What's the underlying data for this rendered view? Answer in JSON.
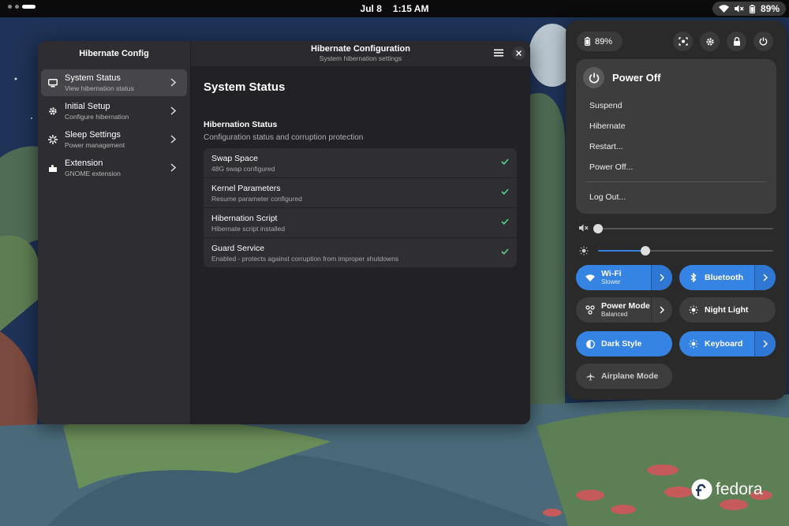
{
  "topbar": {
    "date": "Jul 8",
    "time": "1:15 AM",
    "battery": "89%"
  },
  "app": {
    "sidebar_title": "Hibernate Config",
    "nav": [
      {
        "label": "System Status",
        "sub": "View hibernation status",
        "icon": "monitor-icon",
        "active": true
      },
      {
        "label": "Initial Setup",
        "sub": "Configure hibernation",
        "icon": "gear-icon"
      },
      {
        "label": "Sleep Settings",
        "sub": "Power management",
        "icon": "sleep-icon"
      },
      {
        "label": "Extension",
        "sub": "GNOME extension",
        "icon": "puzzle-icon"
      }
    ],
    "header_title": "Hibernate Configuration",
    "header_subtitle": "System hibernation settings",
    "page_title": "System Status",
    "group_title": "Hibernation Status",
    "group_subtitle": "Configuration status and corruption protection",
    "rows": [
      {
        "title": "Swap Space",
        "sub": "48G swap configured"
      },
      {
        "title": "Kernel Parameters",
        "sub": "Resume parameter configured"
      },
      {
        "title": "Hibernation Script",
        "sub": "Hibernate script installed"
      },
      {
        "title": "Guard Service",
        "sub": "Enabled - protects against corruption from improper shutdowns"
      }
    ]
  },
  "quick_settings": {
    "battery": "89%",
    "power_menu": {
      "title": "Power Off",
      "items": [
        "Suspend",
        "Hibernate",
        "Restart...",
        "Power Off..."
      ],
      "logout": "Log Out..."
    },
    "volume_level": 0.0,
    "brightness_level": 0.27,
    "tiles": {
      "wifi": {
        "label": "Wi-Fi",
        "sub": "Slower"
      },
      "bluetooth": {
        "label": "Bluetooth"
      },
      "power_mode": {
        "label": "Power Mode",
        "sub": "Balanced"
      },
      "night_light": {
        "label": "Night Light"
      },
      "dark_style": {
        "label": "Dark Style"
      },
      "keyboard": {
        "label": "Keyboard"
      },
      "airplane": {
        "label": "Airplane Mode"
      }
    },
    "accent": "#3584e4"
  },
  "branding": {
    "logo_text": "fedora"
  }
}
